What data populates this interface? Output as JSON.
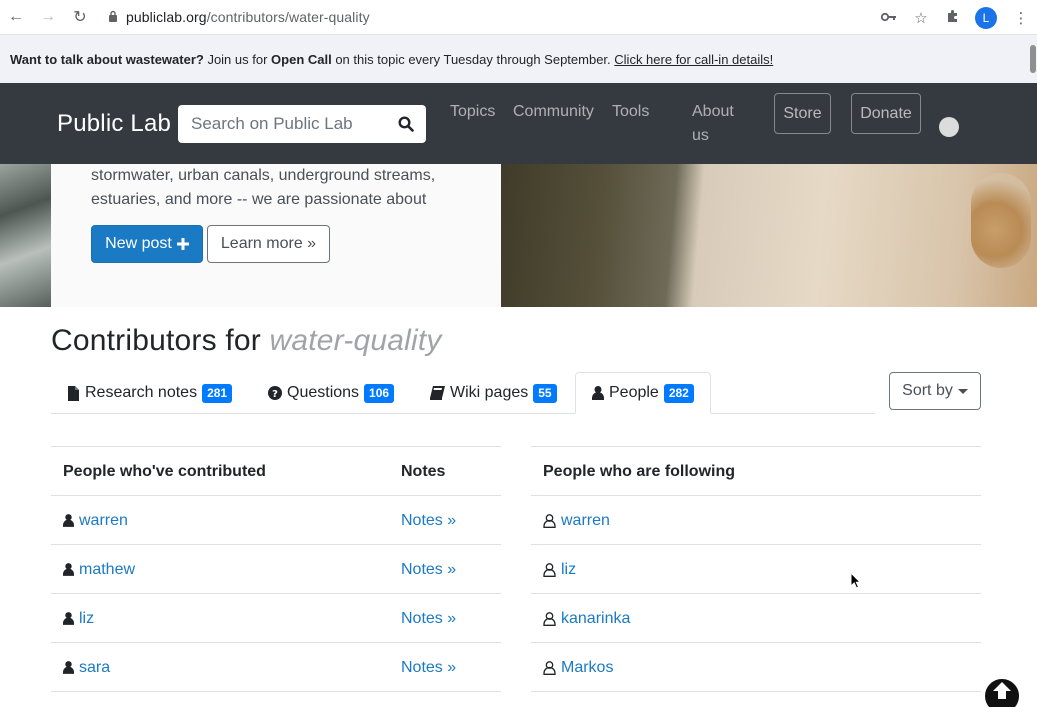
{
  "browser": {
    "url_domain": "publiclab.org",
    "url_path": "/contributors/water-quality",
    "profile_initial": "L"
  },
  "banner": {
    "lead": "Want to talk about wastewater?",
    "mid1": " Join us for ",
    "bold": "Open Call",
    "mid2": " on this topic every Tuesday through September. ",
    "link": "Click here for call-in details!"
  },
  "navbar": {
    "brand": "Public Lab",
    "search_placeholder": "Search on Public Lab",
    "links": [
      "Topics",
      "Community",
      "Tools",
      "About",
      "us"
    ],
    "store": "Store",
    "donate": "Donate"
  },
  "hero": {
    "line1": "stormwater, urban canals, underground streams,",
    "line2": "estuaries, and more -- we are passionate about",
    "new_post": "New post",
    "learn_more": "Learn more »"
  },
  "title": {
    "prefix": "Contributors for ",
    "tag": "water-quality"
  },
  "tabs": [
    {
      "label": "Research notes",
      "count": "281"
    },
    {
      "label": "Questions",
      "count": "106"
    },
    {
      "label": "Wiki pages",
      "count": "55"
    },
    {
      "label": "People",
      "count": "282"
    }
  ],
  "sort_label": "Sort by",
  "contributed": {
    "header_people": "People who've contributed",
    "header_notes": "Notes",
    "rows": [
      {
        "name": "warren",
        "notes": "Notes »"
      },
      {
        "name": "mathew",
        "notes": "Notes »"
      },
      {
        "name": "liz",
        "notes": "Notes »"
      },
      {
        "name": "sara",
        "notes": "Notes »"
      }
    ]
  },
  "following": {
    "header": "People who are following",
    "rows": [
      "warren",
      "liz",
      "kanarinka",
      "Markos"
    ]
  },
  "colors": {
    "navbar": "#343a40",
    "link": "#1b7ac4",
    "badge": "#007bff",
    "primary_button": "#1b7ac4"
  }
}
